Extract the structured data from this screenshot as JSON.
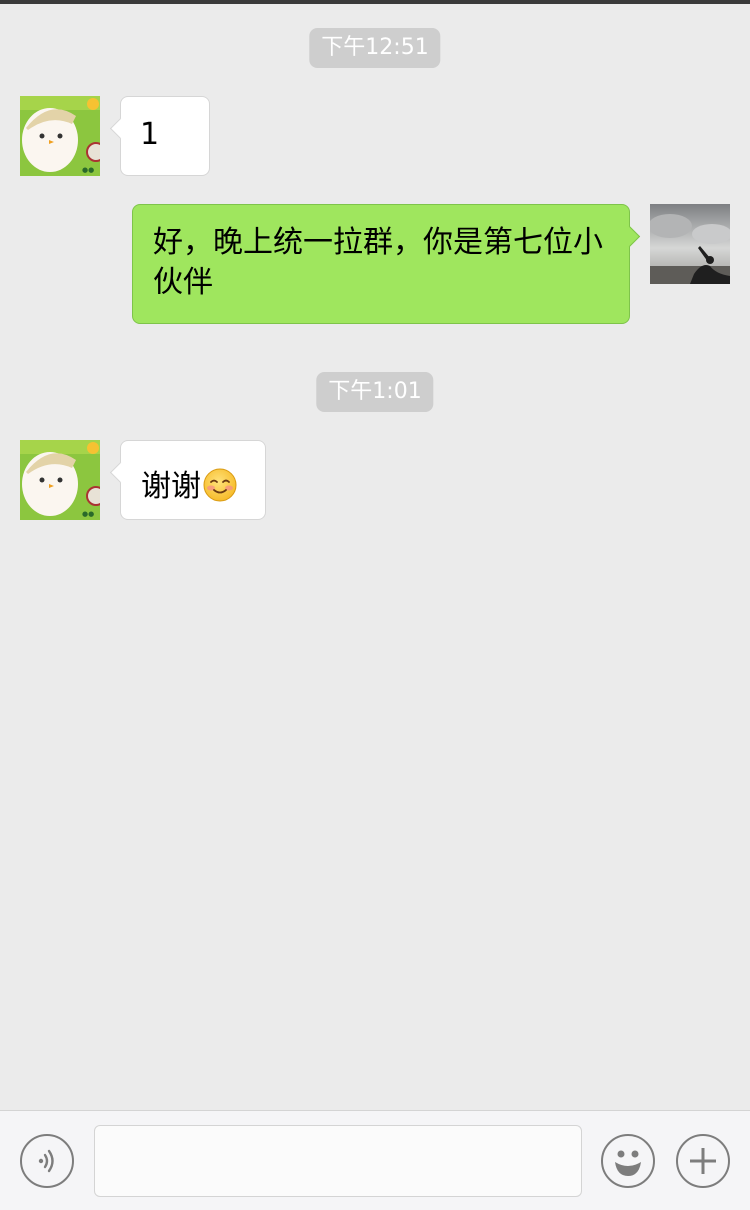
{
  "messages": [
    {
      "type": "time",
      "text": "下午12:51"
    },
    {
      "type": "incoming",
      "sender": "friend",
      "text": "1"
    },
    {
      "type": "outgoing",
      "sender": "me",
      "text": "好，晚上统一拉群，你是第七位小伙伴"
    },
    {
      "type": "time",
      "text": "下午1:01"
    },
    {
      "type": "incoming",
      "sender": "friend",
      "text": "谢谢",
      "emoji": "smiling-face-emoji"
    }
  ],
  "input_bar": {
    "voice_icon": "voice-icon",
    "emoji_icon": "emoji-icon",
    "plus_icon": "plus-icon",
    "text_value": ""
  },
  "colors": {
    "background": "#ebebeb",
    "incoming_bubble": "#ffffff",
    "outgoing_bubble": "#9fe65e",
    "timestamp_bg": "#cecece"
  }
}
